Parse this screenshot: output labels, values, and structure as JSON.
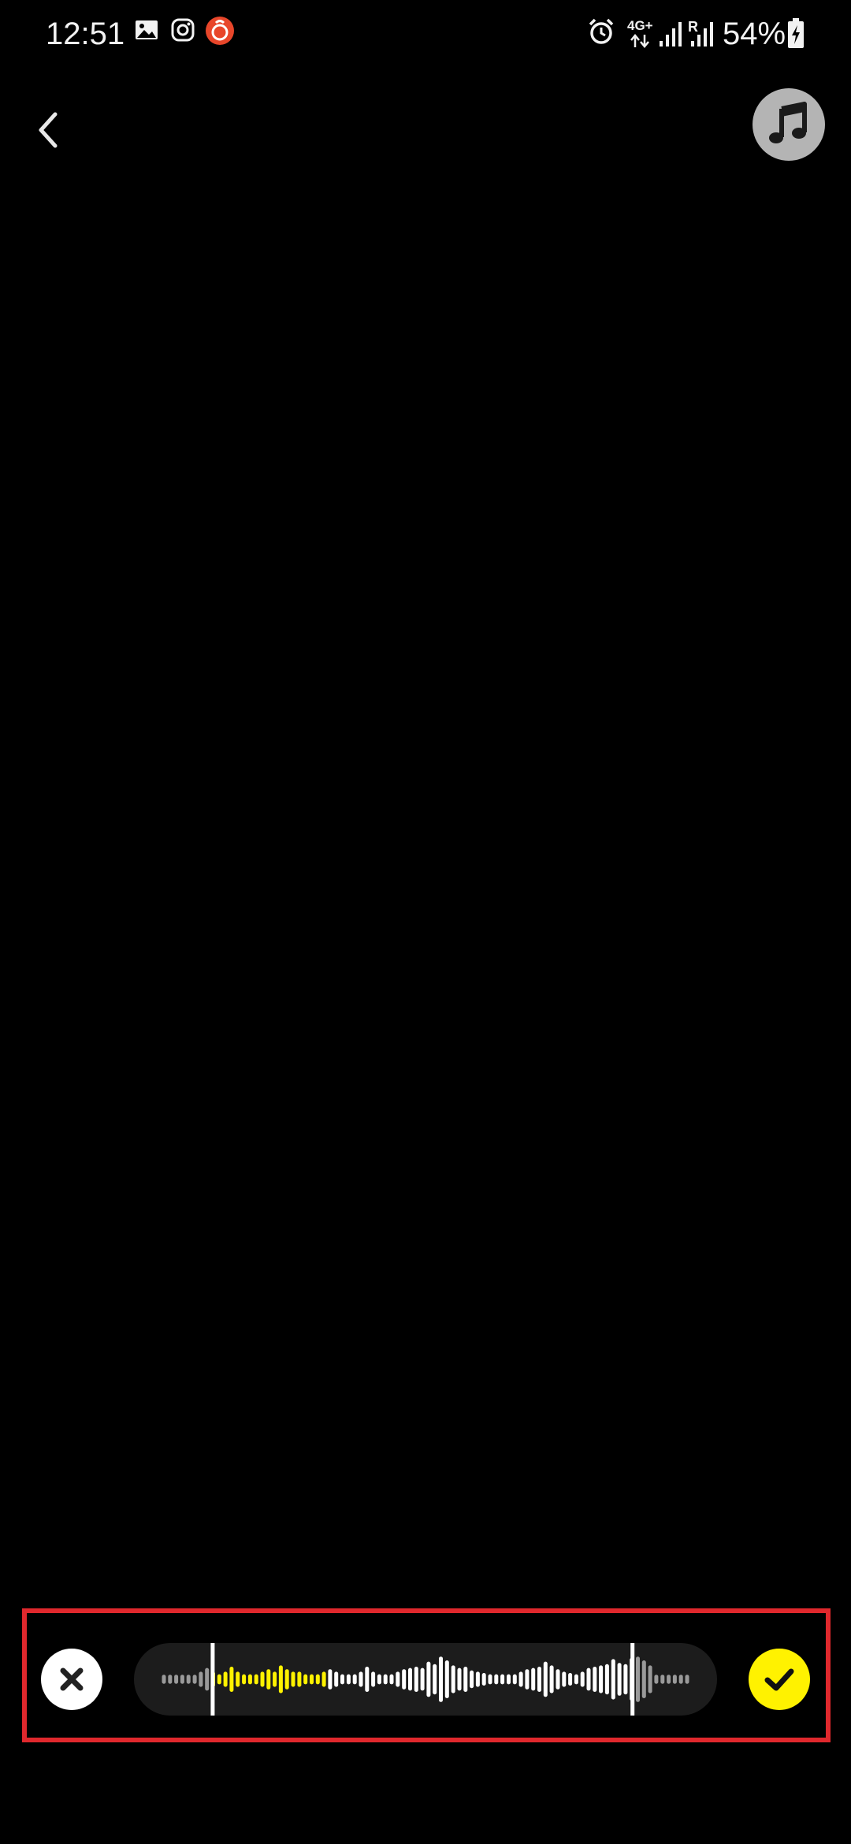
{
  "status_bar": {
    "time": "12:51",
    "network": "4G+",
    "roaming": "R",
    "battery": "54%",
    "left_icons": [
      "gallery-icon",
      "instagram-icon",
      "app-notification-icon"
    ],
    "right_icons": [
      "alarm-icon",
      "data-arrows-icon",
      "signal-icon",
      "signal-roaming-icon",
      "battery-charging-icon"
    ]
  },
  "top_bar": {
    "back_icon": "chevron-left-icon",
    "music_icon": "music-note-icon"
  },
  "trim_panel": {
    "cancel_icon": "close-icon",
    "confirm_icon": "checkmark-icon",
    "colors": {
      "highlight": "#e0282d",
      "confirm": "#fff200",
      "selected_wave": "#fff200",
      "unselected_wave": "#ffffff",
      "outside_wave": "#9a9a9a",
      "track": "#1c1c1c"
    },
    "waveform": {
      "selection_start": 0.135,
      "selection_end": 0.855,
      "highlighted_end": 0.33,
      "levels": [
        0.18,
        0.18,
        0.18,
        0.18,
        0.18,
        0.18,
        0.3,
        0.45,
        0.3,
        0.2,
        0.3,
        0.5,
        0.3,
        0.2,
        0.2,
        0.2,
        0.3,
        0.4,
        0.3,
        0.55,
        0.4,
        0.3,
        0.3,
        0.2,
        0.2,
        0.2,
        0.3,
        0.4,
        0.3,
        0.2,
        0.2,
        0.2,
        0.3,
        0.5,
        0.3,
        0.2,
        0.2,
        0.2,
        0.3,
        0.4,
        0.45,
        0.5,
        0.45,
        0.7,
        0.6,
        0.9,
        0.75,
        0.55,
        0.45,
        0.5,
        0.35,
        0.3,
        0.25,
        0.2,
        0.2,
        0.2,
        0.2,
        0.2,
        0.3,
        0.4,
        0.45,
        0.5,
        0.7,
        0.55,
        0.4,
        0.3,
        0.25,
        0.2,
        0.3,
        0.45,
        0.5,
        0.55,
        0.6,
        0.8,
        0.65,
        0.6,
        0.85,
        0.9,
        0.75,
        0.55,
        0.18,
        0.18,
        0.18,
        0.18,
        0.18,
        0.18
      ]
    }
  }
}
